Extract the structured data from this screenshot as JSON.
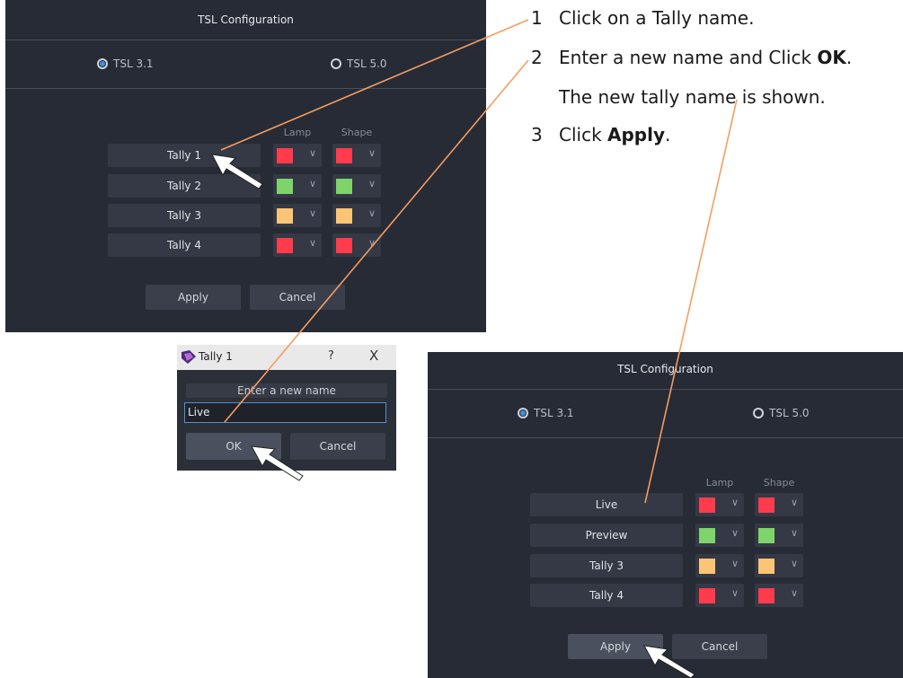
{
  "panel1": {
    "title": "TSL Configuration",
    "radio_31": "TSL 3.1",
    "radio_50": "TSL 5.0",
    "lamp_header": "Lamp",
    "shape_header": "Shape",
    "tallies": [
      "Tally 1",
      "Tally 2",
      "Tally 3",
      "Tally 4"
    ],
    "apply": "Apply",
    "cancel": "Cancel"
  },
  "dialog": {
    "title": "Tally 1",
    "help": "?",
    "close": "X",
    "prompt": "Enter a new name",
    "value": "Live",
    "ok": "OK",
    "cancel": "Cancel"
  },
  "panel2": {
    "title": "TSL Configuration",
    "radio_31": "TSL 3.1",
    "radio_50": "TSL 5.0",
    "lamp_header": "Lamp",
    "shape_header": "Shape",
    "tallies": [
      "Live",
      "Preview",
      "Tally 3",
      "Tally 4"
    ],
    "apply": "Apply",
    "cancel": "Cancel"
  },
  "colors": {
    "red": "#ff3b4c",
    "green": "#7ed36b",
    "amber": "#fcc576",
    "accent": "#3d8fe0",
    "callout_line": "#f59d62"
  },
  "instructions": {
    "step1_num": "1",
    "step1": "Click on a Tally name.",
    "step2_num": "2",
    "step2_a": "Enter a new name and Click ",
    "step2_b": "OK",
    "step2_c": ".",
    "step2_note": "The new tally name is shown.",
    "step3_num": "3",
    "step3_a": "Click ",
    "step3_b": "Apply",
    "step3_c": "."
  }
}
